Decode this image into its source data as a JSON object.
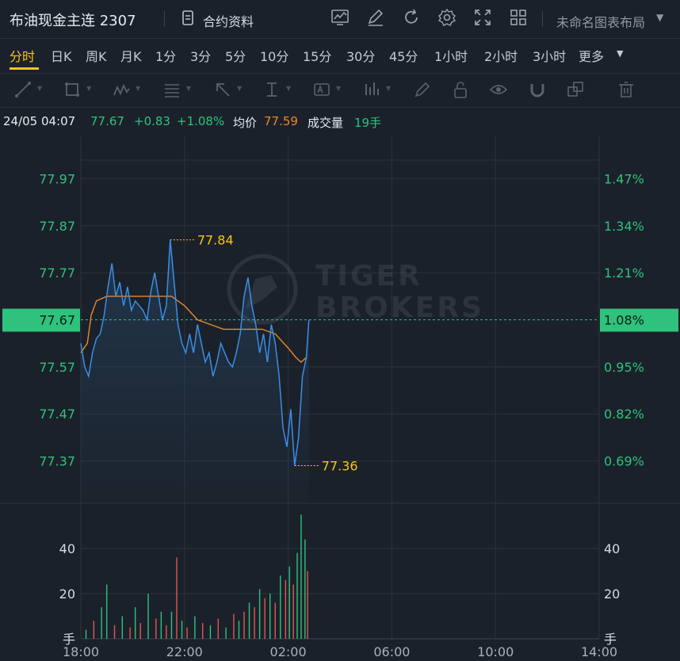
{
  "header": {
    "symbol_title": "布油现金主连 2307",
    "contract_info_label": "合约资料",
    "layout_label": "未命名图表布局",
    "icons": [
      "chart-style-icon",
      "draw-icon",
      "refresh-icon",
      "settings-icon",
      "fullscreen-icon",
      "grid-layout-icon"
    ]
  },
  "timeframes": [
    "分时",
    "日K",
    "周K",
    "月K",
    "1分",
    "3分",
    "5分",
    "10分",
    "15分",
    "30分",
    "45分",
    "1小时",
    "2小时",
    "3小时",
    "更多"
  ],
  "active_timeframe": "分时",
  "toolbar_icons": [
    "line-tool-icon",
    "rect-tool-icon",
    "pattern-tool-icon",
    "fib-tool-icon",
    "arrow-tool-icon",
    "measure-tool-icon",
    "text-tool-icon",
    "indicator-tool-icon",
    "pen-icon",
    "lock-icon",
    "eye-icon",
    "magnet-icon",
    "copy-icon",
    "trash-icon"
  ],
  "info": {
    "datetime": "24/05 04:07",
    "price": "77.67",
    "change": "+0.83",
    "change_pct": "+1.08%",
    "avg_label": "均价",
    "avg_value": "77.59",
    "volume_label": "成交量",
    "volume_value": "19手"
  },
  "watermark": [
    "TIGER",
    "BROKERS"
  ],
  "colors": {
    "price_line": "#3a8ee6",
    "avg_line": "#e8892a",
    "up": "#2fc27c",
    "down": "#e05656",
    "accent": "#f5c518",
    "current_price_bg": "#2fc27c"
  },
  "chart_data": {
    "type": "line",
    "price_axis_left": [
      "77.97",
      "77.87",
      "77.77",
      "77.67",
      "77.57",
      "77.47",
      "77.37"
    ],
    "price_axis_right": [
      "1.47%",
      "1.34%",
      "1.21%",
      "1.08%",
      "0.95%",
      "0.82%",
      "0.69%"
    ],
    "current_price_label": "77.67",
    "current_pct_label": "1.08%",
    "high_label": "77.84",
    "low_label": "77.36",
    "x_ticks": [
      "18:00",
      "22:00",
      "02:00",
      "06:00",
      "10:00",
      "14:00"
    ],
    "volume_axis_labels": [
      "40",
      "20",
      "手"
    ],
    "price_range": [
      77.28,
      78.06
    ],
    "volume_range": [
      0,
      60
    ],
    "series": [
      {
        "name": "price",
        "points": [
          [
            0,
            77.62
          ],
          [
            0.15,
            77.57
          ],
          [
            0.3,
            77.55
          ],
          [
            0.45,
            77.6
          ],
          [
            0.6,
            77.63
          ],
          [
            0.75,
            77.64
          ],
          [
            0.9,
            77.68
          ],
          [
            1.05,
            77.74
          ],
          [
            1.2,
            77.79
          ],
          [
            1.35,
            77.72
          ],
          [
            1.5,
            77.75
          ],
          [
            1.65,
            77.7
          ],
          [
            1.8,
            77.74
          ],
          [
            1.95,
            77.69
          ],
          [
            2.1,
            77.71
          ],
          [
            2.25,
            77.7
          ],
          [
            2.4,
            77.69
          ],
          [
            2.55,
            77.67
          ],
          [
            2.7,
            77.73
          ],
          [
            2.85,
            77.77
          ],
          [
            3.0,
            77.72
          ],
          [
            3.15,
            77.67
          ],
          [
            3.3,
            77.7
          ],
          [
            3.45,
            77.84
          ],
          [
            3.6,
            77.75
          ],
          [
            3.75,
            77.66
          ],
          [
            3.9,
            77.62
          ],
          [
            4.05,
            77.6
          ],
          [
            4.2,
            77.64
          ],
          [
            4.35,
            77.6
          ],
          [
            4.5,
            77.66
          ],
          [
            4.65,
            77.62
          ],
          [
            4.8,
            77.58
          ],
          [
            4.95,
            77.6
          ],
          [
            5.1,
            77.55
          ],
          [
            5.25,
            77.58
          ],
          [
            5.4,
            77.62
          ],
          [
            5.55,
            77.6
          ],
          [
            5.7,
            77.58
          ],
          [
            5.85,
            77.57
          ],
          [
            6.0,
            77.6
          ],
          [
            6.15,
            77.64
          ],
          [
            6.3,
            77.72
          ],
          [
            6.45,
            77.76
          ],
          [
            6.6,
            77.7
          ],
          [
            6.75,
            77.66
          ],
          [
            6.9,
            77.6
          ],
          [
            7.05,
            77.64
          ],
          [
            7.2,
            77.58
          ],
          [
            7.35,
            77.66
          ],
          [
            7.5,
            77.62
          ],
          [
            7.65,
            77.55
          ],
          [
            7.8,
            77.44
          ],
          [
            7.95,
            77.4
          ],
          [
            8.1,
            77.48
          ],
          [
            8.25,
            77.36
          ],
          [
            8.4,
            77.42
          ],
          [
            8.55,
            77.55
          ],
          [
            8.7,
            77.59
          ],
          [
            8.8,
            77.67
          ]
        ]
      },
      {
        "name": "average",
        "points": [
          [
            0,
            77.6
          ],
          [
            0.25,
            77.62
          ],
          [
            0.4,
            77.68
          ],
          [
            0.6,
            77.71
          ],
          [
            1.0,
            77.72
          ],
          [
            2.0,
            77.72
          ],
          [
            3.0,
            77.72
          ],
          [
            3.5,
            77.72
          ],
          [
            4.0,
            77.7
          ],
          [
            4.5,
            77.67
          ],
          [
            5.0,
            77.66
          ],
          [
            5.5,
            77.65
          ],
          [
            6.0,
            77.65
          ],
          [
            6.5,
            77.65
          ],
          [
            7.0,
            77.65
          ],
          [
            7.5,
            77.64
          ],
          [
            8.0,
            77.61
          ],
          [
            8.3,
            77.59
          ],
          [
            8.5,
            77.58
          ],
          [
            8.7,
            77.59
          ]
        ]
      }
    ],
    "volume": [
      {
        "t": 0.2,
        "v": 4,
        "up": true
      },
      {
        "t": 0.5,
        "v": 8,
        "up": false
      },
      {
        "t": 0.8,
        "v": 14,
        "up": true
      },
      {
        "t": 1.0,
        "v": 24,
        "up": true
      },
      {
        "t": 1.3,
        "v": 6,
        "up": false
      },
      {
        "t": 1.6,
        "v": 10,
        "up": true
      },
      {
        "t": 1.9,
        "v": 5,
        "up": false
      },
      {
        "t": 2.1,
        "v": 14,
        "up": true
      },
      {
        "t": 2.3,
        "v": 7,
        "up": false
      },
      {
        "t": 2.6,
        "v": 20,
        "up": true
      },
      {
        "t": 2.9,
        "v": 9,
        "up": false
      },
      {
        "t": 3.1,
        "v": 12,
        "up": true
      },
      {
        "t": 3.3,
        "v": 6,
        "up": false
      },
      {
        "t": 3.5,
        "v": 12,
        "up": true
      },
      {
        "t": 3.7,
        "v": 36,
        "up": false
      },
      {
        "t": 3.9,
        "v": 8,
        "up": true
      },
      {
        "t": 4.1,
        "v": 5,
        "up": false
      },
      {
        "t": 4.4,
        "v": 10,
        "up": true
      },
      {
        "t": 4.7,
        "v": 7,
        "up": false
      },
      {
        "t": 5.0,
        "v": 6,
        "up": true
      },
      {
        "t": 5.3,
        "v": 9,
        "up": false
      },
      {
        "t": 5.6,
        "v": 5,
        "up": true
      },
      {
        "t": 5.9,
        "v": 11,
        "up": false
      },
      {
        "t": 6.1,
        "v": 8,
        "up": true
      },
      {
        "t": 6.3,
        "v": 12,
        "up": false
      },
      {
        "t": 6.5,
        "v": 16,
        "up": true
      },
      {
        "t": 6.7,
        "v": 14,
        "up": false
      },
      {
        "t": 6.9,
        "v": 22,
        "up": true
      },
      {
        "t": 7.1,
        "v": 18,
        "up": false
      },
      {
        "t": 7.3,
        "v": 20,
        "up": true
      },
      {
        "t": 7.5,
        "v": 16,
        "up": false
      },
      {
        "t": 7.7,
        "v": 28,
        "up": true
      },
      {
        "t": 7.9,
        "v": 26,
        "up": false
      },
      {
        "t": 8.05,
        "v": 32,
        "up": true
      },
      {
        "t": 8.2,
        "v": 24,
        "up": false
      },
      {
        "t": 8.35,
        "v": 38,
        "up": true
      },
      {
        "t": 8.5,
        "v": 55,
        "up": true
      },
      {
        "t": 8.65,
        "v": 44,
        "up": true
      },
      {
        "t": 8.75,
        "v": 30,
        "up": false
      }
    ]
  }
}
